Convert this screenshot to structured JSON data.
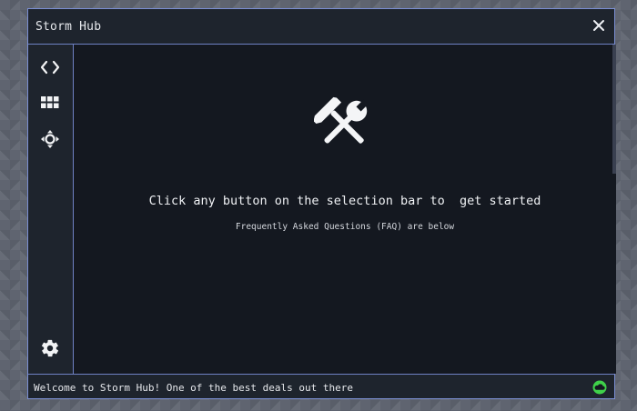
{
  "window": {
    "title": "Storm Hub"
  },
  "sidebar": {
    "items": [
      {
        "icon": "code-icon"
      },
      {
        "icon": "grid-icon"
      },
      {
        "icon": "move-icon"
      }
    ],
    "settings_icon": "gear-icon"
  },
  "main": {
    "icon": "tools-icon",
    "headline": "Click any button on the selection bar to  get started",
    "subline": "Frequently Asked Questions (FAQ) are below"
  },
  "status": {
    "text": "Welcome to Storm Hub! One of the best deals out there",
    "icon": "cloud-icon",
    "icon_color": "#3fd14a"
  },
  "colors": {
    "accent": "#7b8fd4",
    "panel": "#1e242d",
    "content": "#141820"
  }
}
